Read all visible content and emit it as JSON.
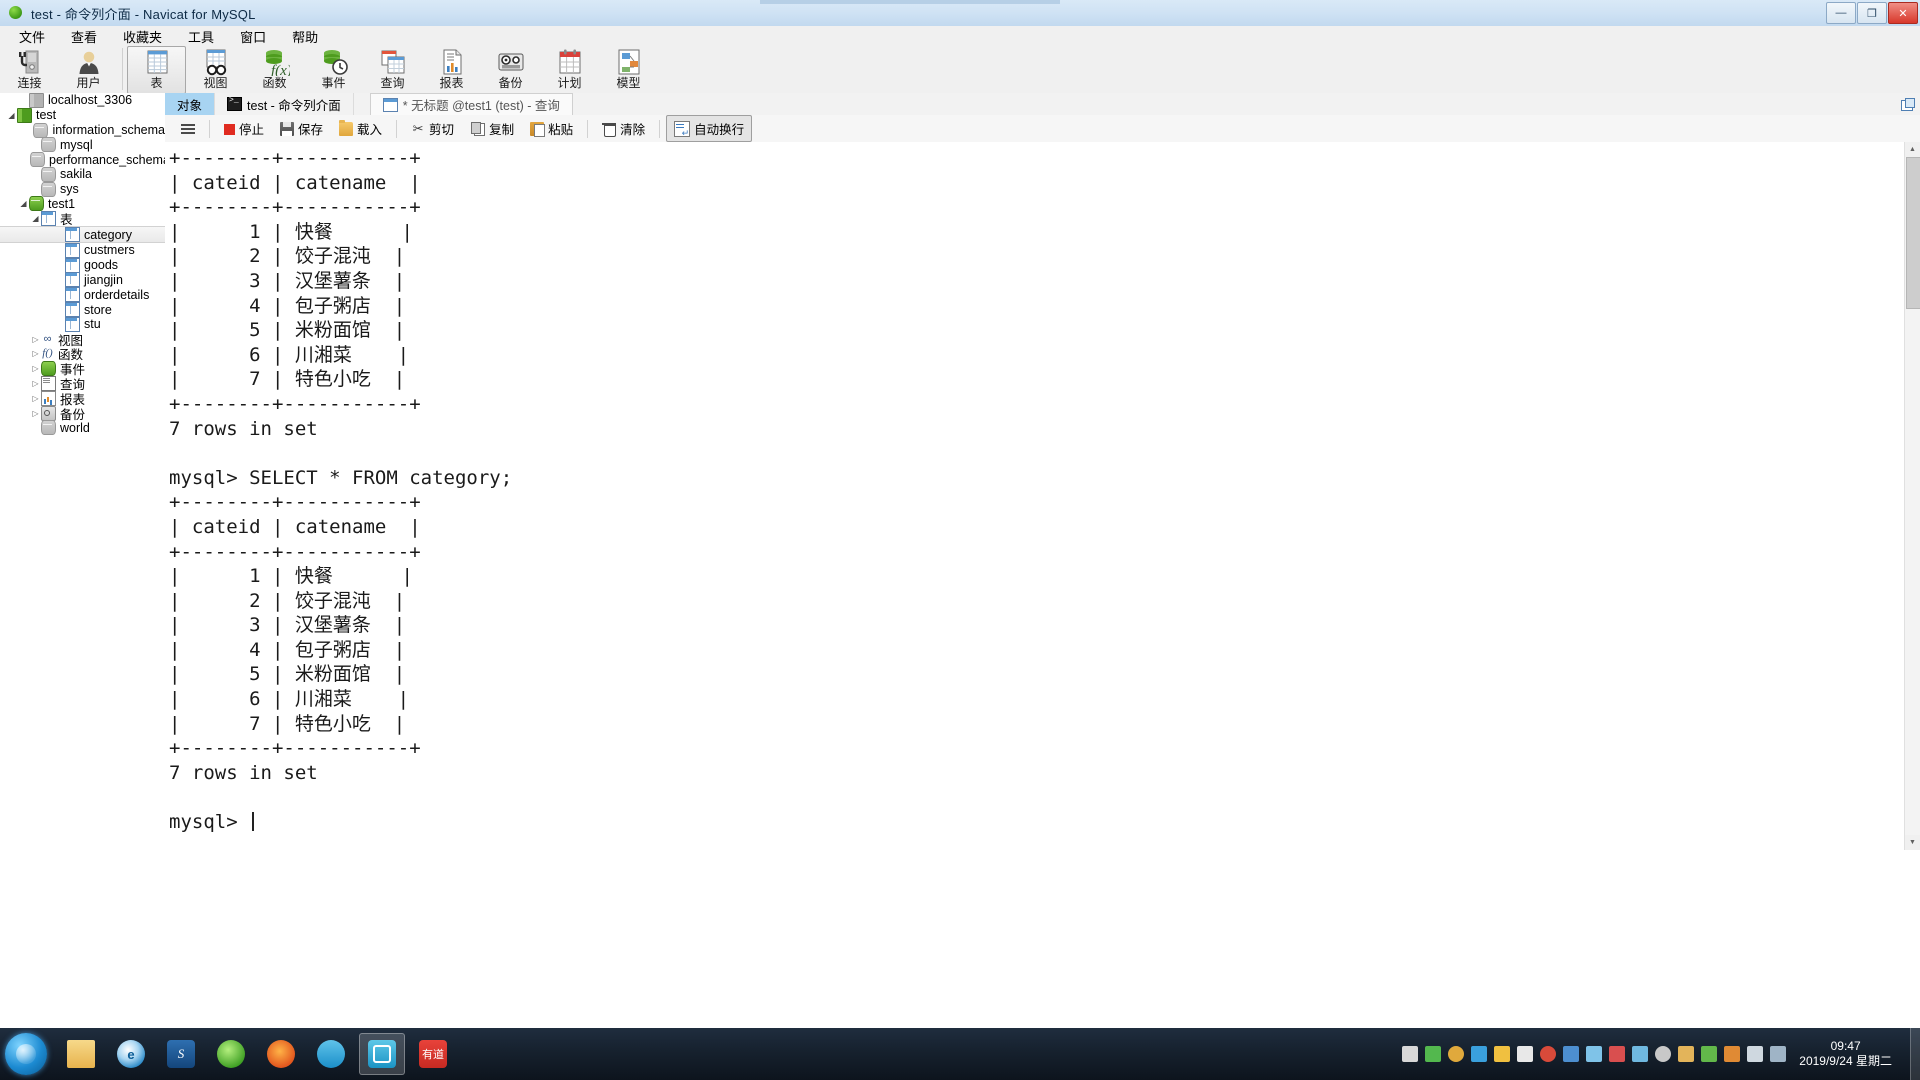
{
  "window": {
    "title": "test - 命令列介面 - Navicat for MySQL",
    "icon": "navicat-green-circle-icon",
    "buttons": {
      "minimize": "—",
      "maximize": "❐",
      "close": "✕"
    }
  },
  "menubar": {
    "items": [
      {
        "label": "文件",
        "name": "menu-file"
      },
      {
        "label": "查看",
        "name": "menu-view"
      },
      {
        "label": "收藏夹",
        "name": "menu-favorites"
      },
      {
        "label": "工具",
        "name": "menu-tools"
      },
      {
        "label": "窗口",
        "name": "menu-window"
      },
      {
        "label": "帮助",
        "name": "menu-help"
      }
    ]
  },
  "toolbar": {
    "groups": [
      [
        {
          "label": "连接",
          "icon": "connection-icon",
          "name": "toolbar-connection",
          "active": false
        },
        {
          "label": "用户",
          "icon": "user-icon",
          "name": "toolbar-user",
          "active": false
        }
      ],
      [
        {
          "label": "表",
          "icon": "table-icon",
          "name": "toolbar-table",
          "active": true
        },
        {
          "label": "视图",
          "icon": "view-icon",
          "name": "toolbar-view",
          "active": false
        },
        {
          "label": "函数",
          "icon": "function-icon",
          "name": "toolbar-function",
          "active": false
        },
        {
          "label": "事件",
          "icon": "event-icon",
          "name": "toolbar-event",
          "active": false
        },
        {
          "label": "查询",
          "icon": "query-icon",
          "name": "toolbar-query",
          "active": false
        },
        {
          "label": "报表",
          "icon": "report-icon",
          "name": "toolbar-report",
          "active": false
        },
        {
          "label": "备份",
          "icon": "backup-icon",
          "name": "toolbar-backup",
          "active": false
        },
        {
          "label": "计划",
          "icon": "schedule-icon",
          "name": "toolbar-schedule",
          "active": false
        },
        {
          "label": "模型",
          "icon": "model-icon",
          "name": "toolbar-model",
          "active": false
        }
      ]
    ]
  },
  "sidebar": {
    "items": [
      {
        "label": "localhost_3306",
        "indent": 1,
        "icon": "server-icon",
        "twisty": "none",
        "selected": false
      },
      {
        "label": "test",
        "indent": 0,
        "icon": "server-green-icon",
        "twisty": "open",
        "selected": false
      },
      {
        "label": "information_schema",
        "indent": 2,
        "icon": "database-icon",
        "twisty": "none",
        "selected": false
      },
      {
        "label": "mysql",
        "indent": 2,
        "icon": "database-icon",
        "twisty": "none",
        "selected": false
      },
      {
        "label": "performance_schema",
        "indent": 2,
        "icon": "database-icon",
        "twisty": "none",
        "selected": false
      },
      {
        "label": "sakila",
        "indent": 2,
        "icon": "database-icon",
        "twisty": "none",
        "selected": false
      },
      {
        "label": "sys",
        "indent": 2,
        "icon": "database-icon",
        "twisty": "none",
        "selected": false
      },
      {
        "label": "test1",
        "indent": 1,
        "icon": "database-green-icon",
        "twisty": "open",
        "selected": false
      },
      {
        "label": "表",
        "indent": 2,
        "icon": "table-blue-icon",
        "twisty": "open",
        "selected": false
      },
      {
        "label": "category",
        "indent": 4,
        "icon": "table-blue-icon",
        "twisty": "none",
        "selected": true
      },
      {
        "label": "custmers",
        "indent": 4,
        "icon": "table-blue-icon",
        "twisty": "none",
        "selected": false
      },
      {
        "label": "goods",
        "indent": 4,
        "icon": "table-blue-icon",
        "twisty": "none",
        "selected": false
      },
      {
        "label": "jiangjin",
        "indent": 4,
        "icon": "table-blue-icon",
        "twisty": "none",
        "selected": false
      },
      {
        "label": "orderdetails",
        "indent": 4,
        "icon": "table-blue-icon",
        "twisty": "none",
        "selected": false
      },
      {
        "label": "store",
        "indent": 4,
        "icon": "table-blue-icon",
        "twisty": "none",
        "selected": false
      },
      {
        "label": "stu",
        "indent": 4,
        "icon": "table-blue-icon",
        "twisty": "none",
        "selected": false
      },
      {
        "label": "视图",
        "indent": 2,
        "icon": "view-glasses-icon",
        "twisty": "closed",
        "selected": false
      },
      {
        "label": "函数",
        "indent": 2,
        "icon": "function-fx-icon",
        "twisty": "closed",
        "selected": false
      },
      {
        "label": "事件",
        "indent": 2,
        "icon": "event-green-icon",
        "twisty": "closed",
        "selected": false
      },
      {
        "label": "查询",
        "indent": 2,
        "icon": "query-doc-icon",
        "twisty": "closed",
        "selected": false
      },
      {
        "label": "报表",
        "indent": 2,
        "icon": "report-chart-icon",
        "twisty": "closed",
        "selected": false
      },
      {
        "label": "备份",
        "indent": 2,
        "icon": "backup-tape-icon",
        "twisty": "closed",
        "selected": false
      },
      {
        "label": "world",
        "indent": 2,
        "icon": "database-icon",
        "twisty": "none",
        "selected": false
      }
    ]
  },
  "tabs": [
    {
      "label": "对象",
      "icon": "",
      "active": true,
      "name": "tab-objects"
    },
    {
      "label": "test - 命令列介面",
      "icon": "console-icon",
      "active": false,
      "name": "tab-command-line"
    },
    {
      "label": "* 无标题 @test1 (test) - 查询",
      "icon": "query-tab-icon",
      "active": false,
      "name": "tab-untitled-query"
    }
  ],
  "cmdbar": {
    "buttons": [
      {
        "label": "",
        "icon": "hamburger-icon",
        "name": "menu-toggle-button",
        "toggled": false
      },
      {
        "label": "停止",
        "icon": "stop-icon",
        "name": "stop-button",
        "toggled": false
      },
      {
        "label": "保存",
        "icon": "save-icon",
        "name": "save-button",
        "toggled": false
      },
      {
        "label": "载入",
        "icon": "folder-icon",
        "name": "load-button",
        "toggled": false
      },
      {
        "label": "剪切",
        "icon": "scissors-icon",
        "name": "cut-button",
        "toggled": false
      },
      {
        "label": "复制",
        "icon": "copy-icon",
        "name": "copy-button",
        "toggled": false
      },
      {
        "label": "粘贴",
        "icon": "paste-icon",
        "name": "paste-button",
        "toggled": false
      },
      {
        "label": "清除",
        "icon": "trash-icon",
        "name": "clear-button",
        "toggled": false
      },
      {
        "label": "自动换行",
        "icon": "wrap-icon",
        "name": "auto-wrap-button",
        "toggled": true
      }
    ]
  },
  "console": {
    "text": "+--------+-----------+\n| cateid | catename  |\n+--------+-----------+\n|      1 | 快餐      |\n|      2 | 饺子混沌  |\n|      3 | 汉堡薯条  |\n|      4 | 包子粥店  |\n|      5 | 米粉面馆  |\n|      6 | 川湘菜    |\n|      7 | 特色小吃  |\n+--------+-----------+\n7 rows in set\n\nmysql> SELECT * FROM category;\n+--------+-----------+\n| cateid | catename  |\n+--------+-----------+\n|      1 | 快餐      |\n|      2 | 饺子混沌  |\n|      3 | 汉堡薯条  |\n|      4 | 包子粥店  |\n|      5 | 米粉面馆  |\n|      6 | 川湘菜    |\n|      7 | 特色小吃  |\n+--------+-----------+\n7 rows in set\n\nmysql> ",
    "query": "mysql> SELECT * FROM category;",
    "result_rows": [
      {
        "cateid": "1",
        "catename": "快餐"
      },
      {
        "cateid": "2",
        "catename": "饺子混沌"
      },
      {
        "cateid": "3",
        "catename": "汉堡薯条"
      },
      {
        "cateid": "4",
        "catename": "包子粥店"
      },
      {
        "cateid": "5",
        "catename": "米粉面馆"
      },
      {
        "cateid": "6",
        "catename": "川湘菜"
      },
      {
        "cateid": "7",
        "catename": "特色小吃"
      }
    ],
    "columns": [
      "cateid",
      "catename"
    ],
    "status": "7 rows in set",
    "prompt": "mysql>"
  },
  "taskbar": {
    "apps": [
      {
        "name": "taskbar-explorer",
        "icon": "folder-icon",
        "selected": false,
        "glyph": ""
      },
      {
        "name": "taskbar-ie",
        "icon": "ie-icon",
        "selected": false,
        "glyph": "e"
      },
      {
        "name": "taskbar-sogou",
        "icon": "sogou-icon",
        "selected": false,
        "glyph": "S"
      },
      {
        "name": "taskbar-green-app",
        "icon": "green-circle-icon",
        "selected": false,
        "glyph": ""
      },
      {
        "name": "taskbar-firefox",
        "icon": "firefox-icon",
        "selected": false,
        "glyph": ""
      },
      {
        "name": "taskbar-qq",
        "icon": "qq-penguin-icon",
        "selected": false,
        "glyph": ""
      },
      {
        "name": "taskbar-navicat",
        "icon": "navicat-icon",
        "selected": true,
        "glyph": ""
      },
      {
        "name": "taskbar-youdao",
        "icon": "youdao-icon",
        "selected": false,
        "glyph": "有道"
      }
    ],
    "clock_time": "09:47",
    "clock_date": "2019/9/24 星期二"
  }
}
